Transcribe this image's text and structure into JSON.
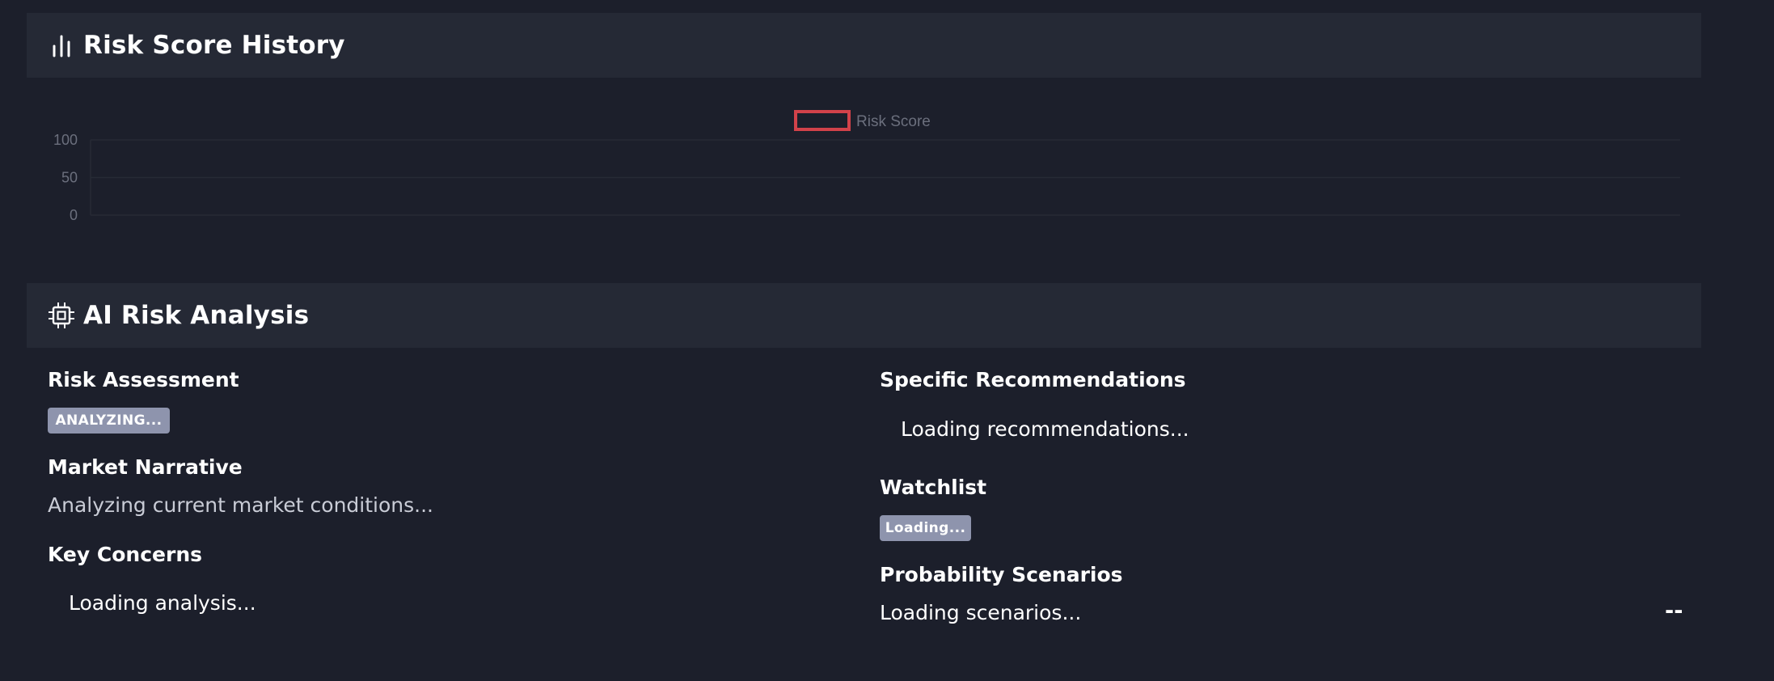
{
  "history_panel": {
    "title": "Risk Score History",
    "icon": "bar-chart-icon"
  },
  "chart_data": {
    "type": "bar",
    "categories": [],
    "series": [
      {
        "name": "Risk Score",
        "values": []
      }
    ],
    "yticks": [
      "100",
      "50",
      "0"
    ],
    "ylim": [
      0,
      100
    ],
    "grid": true,
    "legend": "top-center",
    "colors": {
      "series": "#d2424a",
      "tick": "#6b6f7d",
      "grid": "#262a35"
    }
  },
  "ai_panel": {
    "title": "AI Risk Analysis",
    "icon": "cpu-chip-icon",
    "risk_assessment": {
      "label": "Risk Assessment",
      "badge": "ANALYZING..."
    },
    "market_narrative": {
      "label": "Market Narrative",
      "text": "Analyzing current market conditions..."
    },
    "key_concerns": {
      "label": "Key Concerns",
      "text": "Loading analysis..."
    },
    "recommendations": {
      "label": "Specific Recommendations",
      "text": "Loading recommendations..."
    },
    "watchlist": {
      "label": "Watchlist",
      "badge": "Loading..."
    },
    "scenarios": {
      "label": "Probability Scenarios",
      "text": "Loading scenarios...",
      "value": "--"
    }
  }
}
